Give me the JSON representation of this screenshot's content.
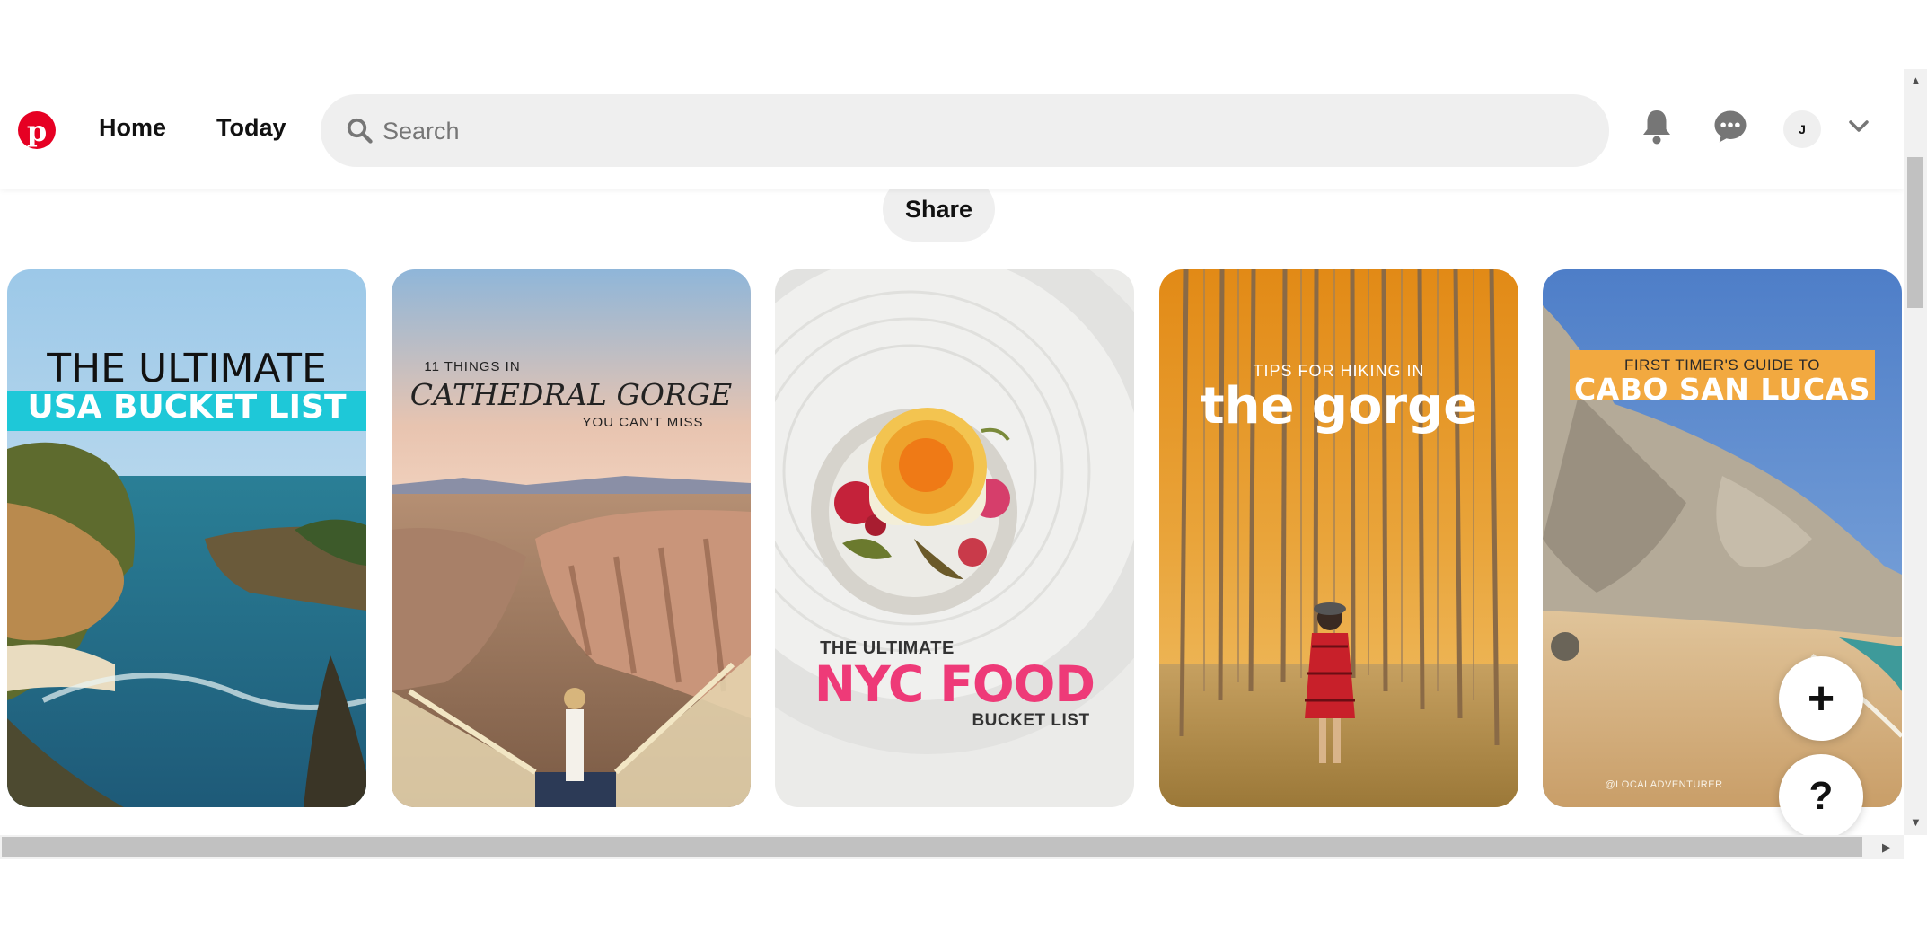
{
  "header": {
    "logo_letter": "p",
    "nav": [
      "Home",
      "Today"
    ],
    "search_placeholder": "Search",
    "avatar_initial": "J",
    "icons": [
      "notifications-bell-icon",
      "messages-icon",
      "chevron-down-icon"
    ]
  },
  "share_label": "Share",
  "pins": [
    {
      "lines": [
        "THE ULTIMATE",
        "USA BUCKET LIST"
      ]
    },
    {
      "lines": [
        "11 THINGS IN",
        "CATHEDRAL GORGE",
        "YOU CAN'T MISS"
      ]
    },
    {
      "lines": [
        "THE ULTIMATE",
        "NYC FOOD",
        "BUCKET LIST"
      ]
    },
    {
      "lines": [
        "TIPS FOR HIKING IN",
        "the gorge"
      ]
    },
    {
      "lines": [
        "FIRST TIMER'S GUIDE TO",
        "CABO SAN LUCAS",
        "@LOCALADVENTURER"
      ]
    }
  ],
  "fabs": {
    "create_label": "+",
    "help_label": "?"
  },
  "colors": {
    "brand": "#e60023",
    "search_bg": "#efefef",
    "usa_band": "#1ec8d8",
    "nyc_pink": "#ee3a78",
    "cabo_band": "#f2a940"
  }
}
